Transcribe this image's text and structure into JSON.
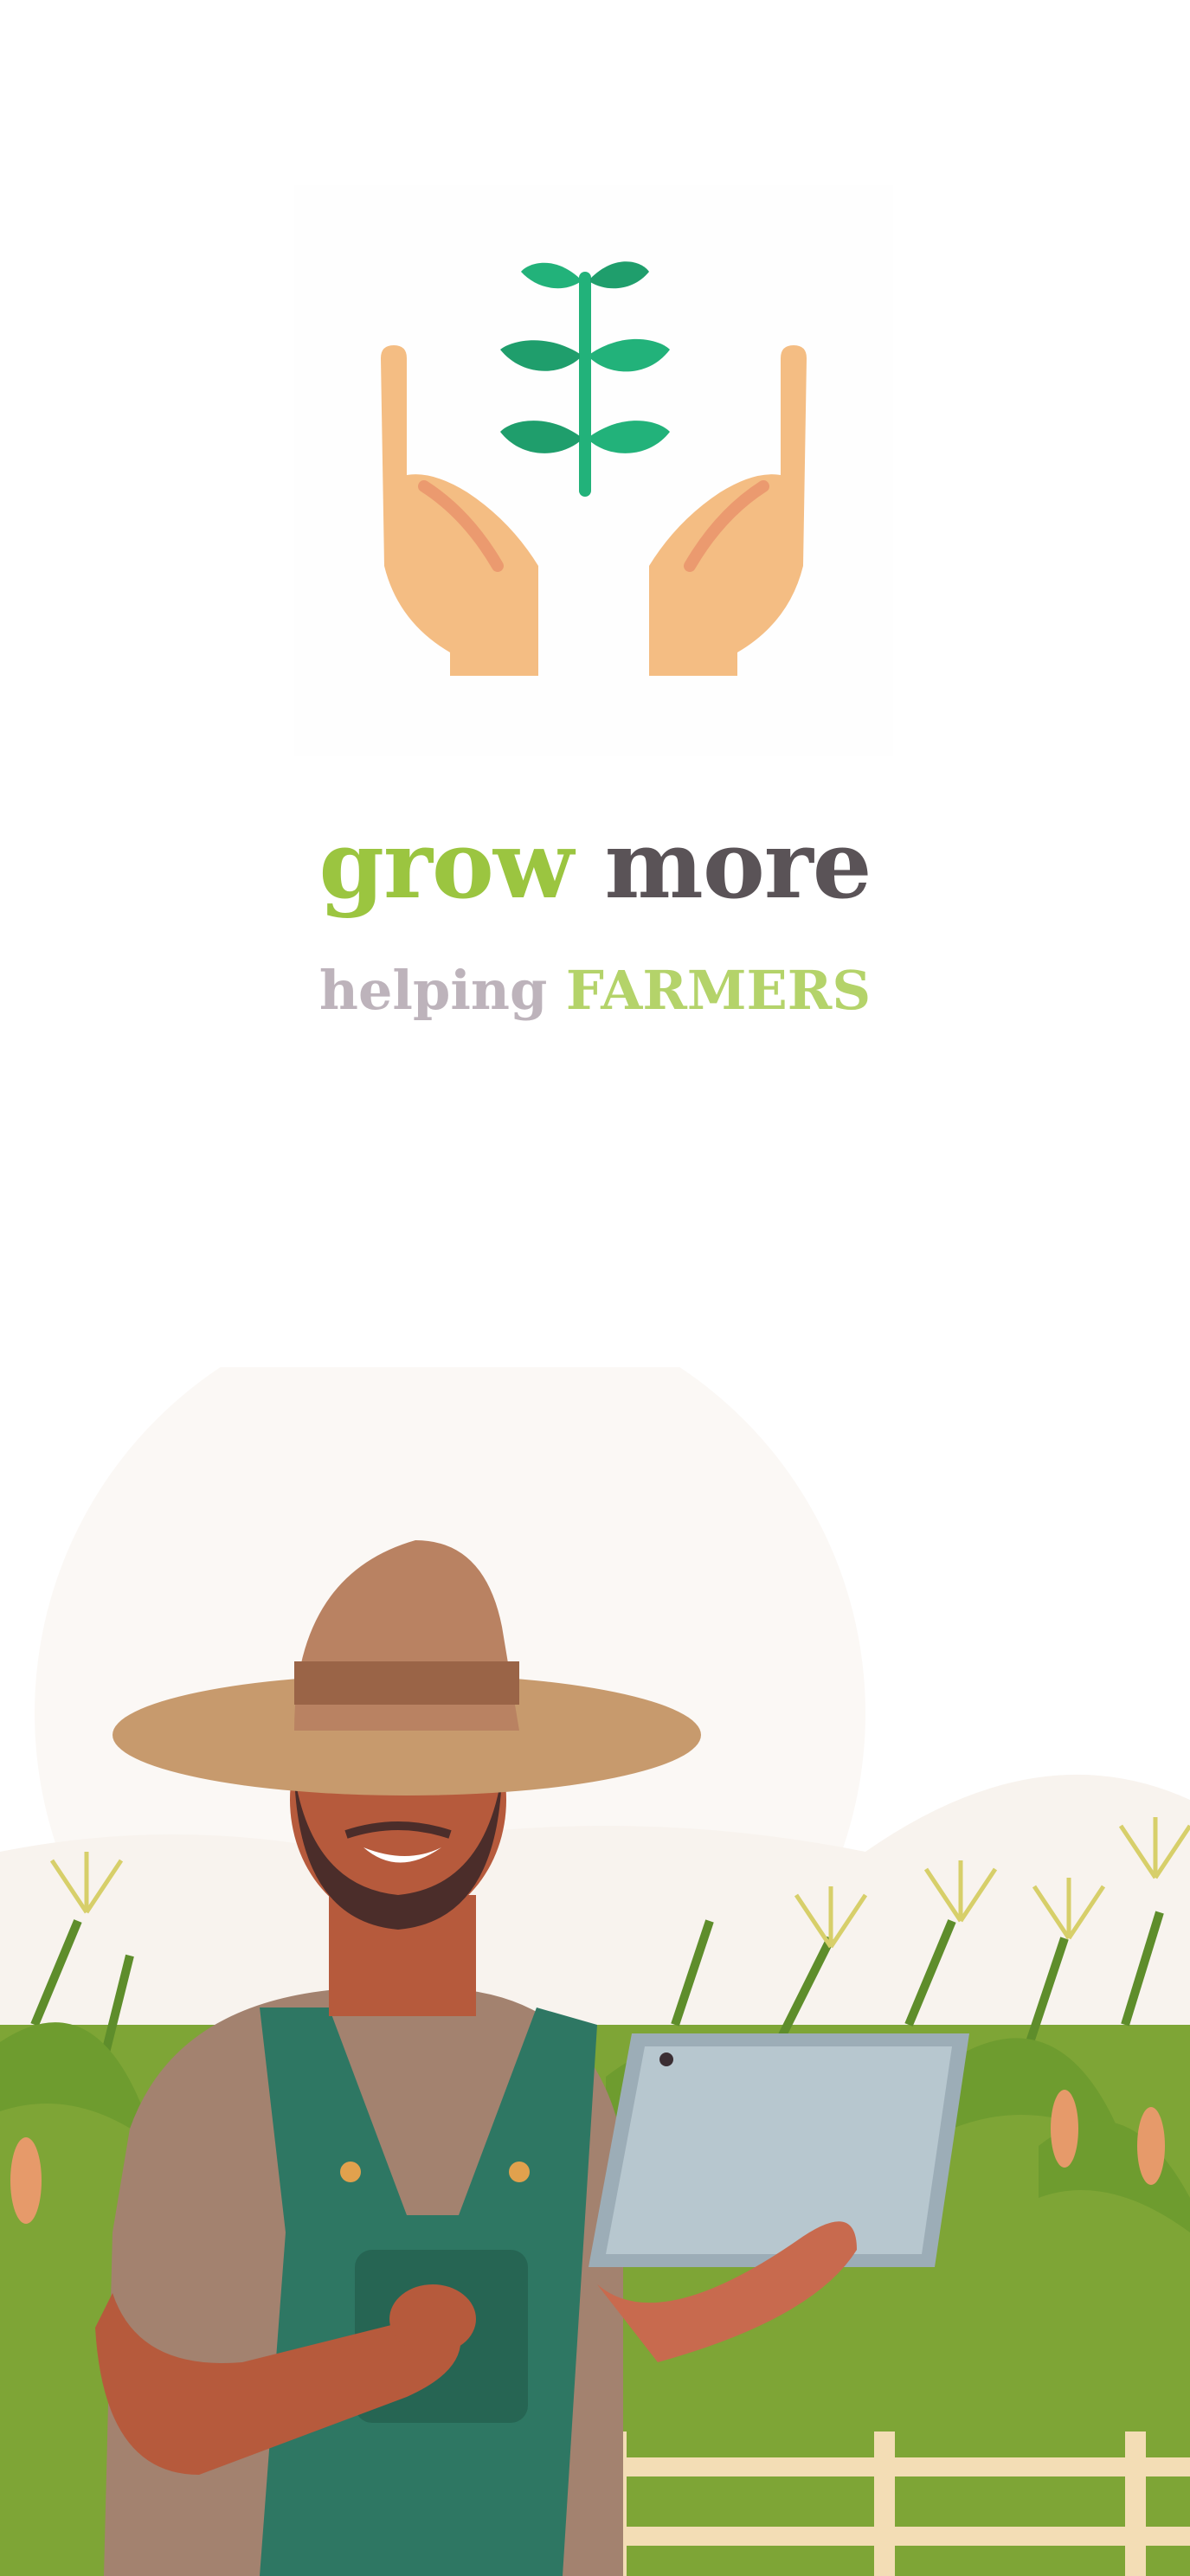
{
  "brand": {
    "title_word_1": "grow",
    "title_word_2": "more",
    "tagline_word_1": "helping",
    "tagline_word_2": "FARMERS"
  },
  "logo": {
    "icon": "hands-holding-sprout-icon"
  },
  "illustration": {
    "icon": "farmer-with-tablet-illustration"
  },
  "colors": {
    "accent_green": "#9bc540",
    "dark_text": "#5a5357",
    "muted_text": "#bdb3bb",
    "light_green": "#b4d36a",
    "leaf_green": "#22b27a",
    "skin": "#f4bd83"
  }
}
